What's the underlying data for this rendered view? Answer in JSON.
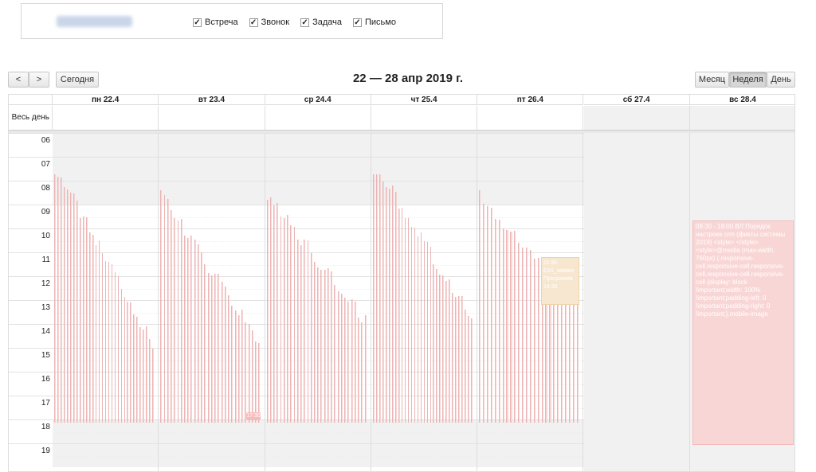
{
  "filters": [
    {
      "label": "Встреча",
      "checked": true
    },
    {
      "label": "Звонок",
      "checked": true
    },
    {
      "label": "Задача",
      "checked": true
    },
    {
      "label": "Письмо",
      "checked": true
    }
  ],
  "toolbar": {
    "prev": "<",
    "next": ">",
    "today": "Сегодня",
    "title": "22 — 28 апр 2019 г.",
    "views": {
      "month": "Месяц",
      "week": "Неделя",
      "day": "День"
    },
    "active_view": "week"
  },
  "days": [
    "пн 22.4",
    "вт 23.4",
    "ср 24.4",
    "чт 25.4",
    "пт 26.4",
    "сб 27.4",
    "вс 28.4"
  ],
  "allday_label": "Весь день",
  "hours": [
    "06",
    "07",
    "08",
    "09",
    "10",
    "11",
    "12",
    "13",
    "14",
    "15",
    "16",
    "17",
    "18",
    "19"
  ],
  "events": {
    "big_event_text": "09:30 - 18:00 ВЛ Порядок настроек crm (фиксы системы 2019) <style> </style> <style>@media (max-width: 760px) {.responsive-cell.responsive-cell.responsive-cell.responsive-cell.responsive-cell {display: block !important;width: 100% !important;padding-left: 0 !important;padding-right: 0 !important;}.mobile-image",
    "task_event_text": "11:30 Е24_заявки Программа 14:30",
    "badge_text": "17:30"
  }
}
